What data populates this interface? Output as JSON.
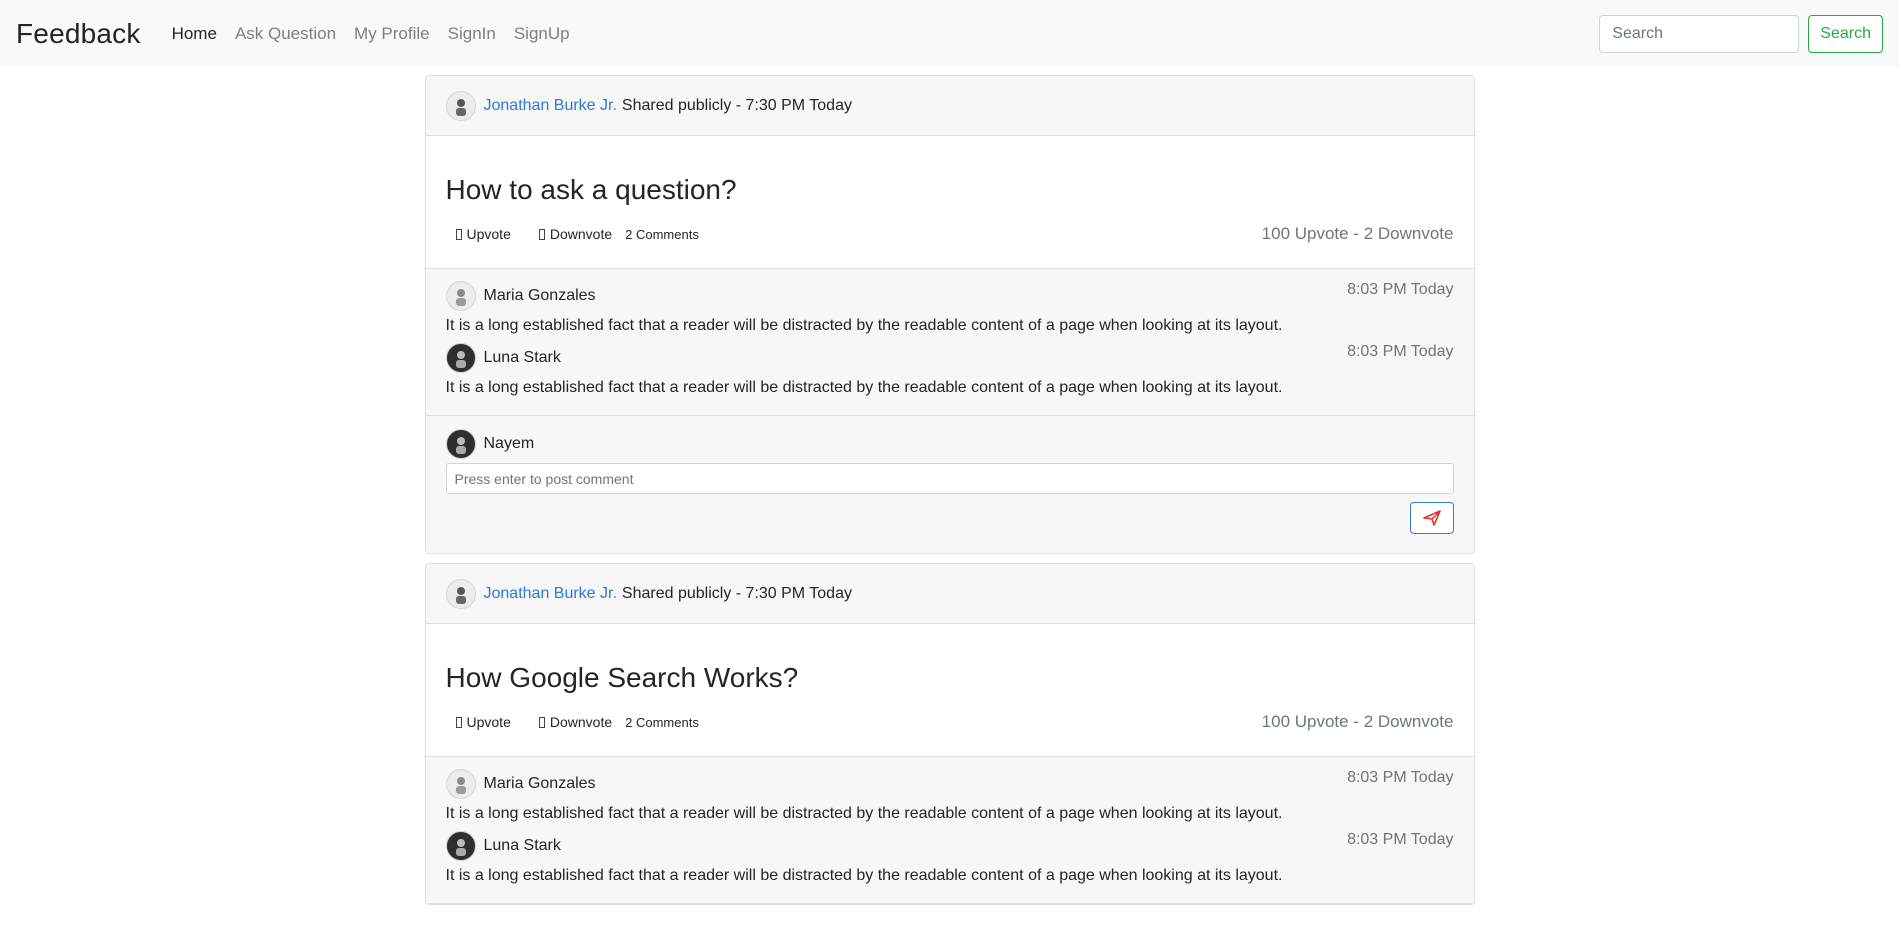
{
  "nav": {
    "brand": "Feedback",
    "links": [
      "Home",
      "Ask Question",
      "My Profile",
      "SignIn",
      "SignUp"
    ],
    "search_placeholder": "Search",
    "search_button": "Search"
  },
  "posts": [
    {
      "author": "Jonathan Burke Jr.",
      "shared": "Shared publicly - 7:30 PM Today",
      "title": "How to ask a question?",
      "upvote_label": "Upvote",
      "downvote_label": "Downvote",
      "comments_label": "2 Comments",
      "votes_summary": "100 Upvote - 2 Downvote",
      "comments": [
        {
          "user": "Maria Gonzales",
          "time": "8:03 PM Today",
          "text": "It is a long established fact that a reader will be distracted by the readable content of a page when looking at its layout."
        },
        {
          "user": "Luna Stark",
          "time": "8:03 PM Today",
          "text": "It is a long established fact that a reader will be distracted by the readable content of a page when looking at its layout."
        }
      ],
      "compose": {
        "user": "Nayem",
        "placeholder": "Press enter to post comment"
      }
    },
    {
      "author": "Jonathan Burke Jr.",
      "shared": "Shared publicly - 7:30 PM Today",
      "title": "How Google Search Works?",
      "upvote_label": "Upvote",
      "downvote_label": "Downvote",
      "comments_label": "2 Comments",
      "votes_summary": "100 Upvote - 2 Downvote",
      "comments": [
        {
          "user": "Maria Gonzales",
          "time": "8:03 PM Today",
          "text": "It is a long established fact that a reader will be distracted by the readable content of a page when looking at its layout."
        },
        {
          "user": "Luna Stark",
          "time": "8:03 PM Today",
          "text": "It is a long established fact that a reader will be distracted by the readable content of a page when looking at its layout."
        }
      ]
    }
  ],
  "colors": {
    "link": "#2b7bd6",
    "success": "#28a745",
    "send_icon": "#e03131"
  },
  "icons": {
    "upvote": "thumbs-up-icon",
    "downvote": "thumbs-down-icon",
    "send": "paper-plane-icon"
  }
}
